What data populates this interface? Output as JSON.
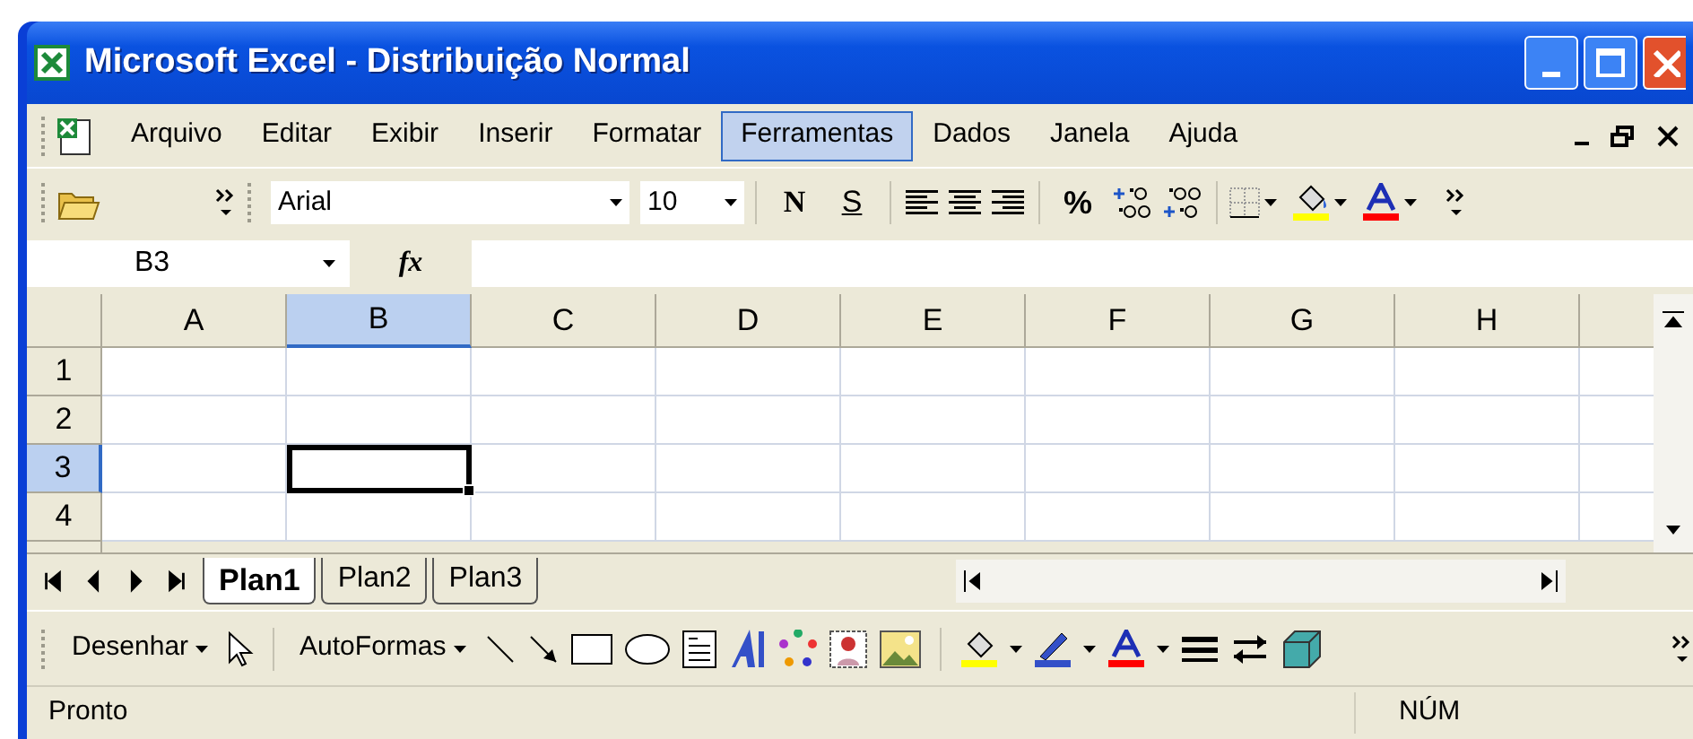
{
  "window": {
    "title": "Microsoft Excel - Distribuição Normal"
  },
  "menu": [
    {
      "label": "Arquivo",
      "selected": false
    },
    {
      "label": "Editar",
      "selected": false
    },
    {
      "label": "Exibir",
      "selected": false
    },
    {
      "label": "Inserir",
      "selected": false
    },
    {
      "label": "Formatar",
      "selected": false
    },
    {
      "label": "Ferramentas",
      "selected": true
    },
    {
      "label": "Dados",
      "selected": false
    },
    {
      "label": "Janela",
      "selected": false
    },
    {
      "label": "Ajuda",
      "selected": false
    }
  ],
  "toolbar": {
    "font": "Arial",
    "size": "10",
    "bold_label": "N",
    "underline_label": "S",
    "percent_label": "%"
  },
  "formula_bar": {
    "name_box": "B3",
    "fx": "fx"
  },
  "sheet": {
    "columns": [
      {
        "label": "A",
        "selected": false
      },
      {
        "label": "B",
        "selected": true
      },
      {
        "label": "C",
        "selected": false
      },
      {
        "label": "D",
        "selected": false
      },
      {
        "label": "E",
        "selected": false
      },
      {
        "label": "F",
        "selected": false
      },
      {
        "label": "G",
        "selected": false
      },
      {
        "label": "H",
        "selected": false
      }
    ],
    "rows": [
      {
        "label": "1",
        "selected": false
      },
      {
        "label": "2",
        "selected": false
      },
      {
        "label": "3",
        "selected": true
      },
      {
        "label": "4",
        "selected": false
      }
    ]
  },
  "sheet_tabs": [
    {
      "label": "Plan1",
      "selected": true
    },
    {
      "label": "Plan2",
      "selected": false
    },
    {
      "label": "Plan3",
      "selected": false
    }
  ],
  "drawing_toolbar": {
    "draw_menu": "Desenhar",
    "autoshapes_menu": "AutoFormas"
  },
  "status_bar": {
    "message": "Pronto",
    "num_lock": "NÚM"
  }
}
